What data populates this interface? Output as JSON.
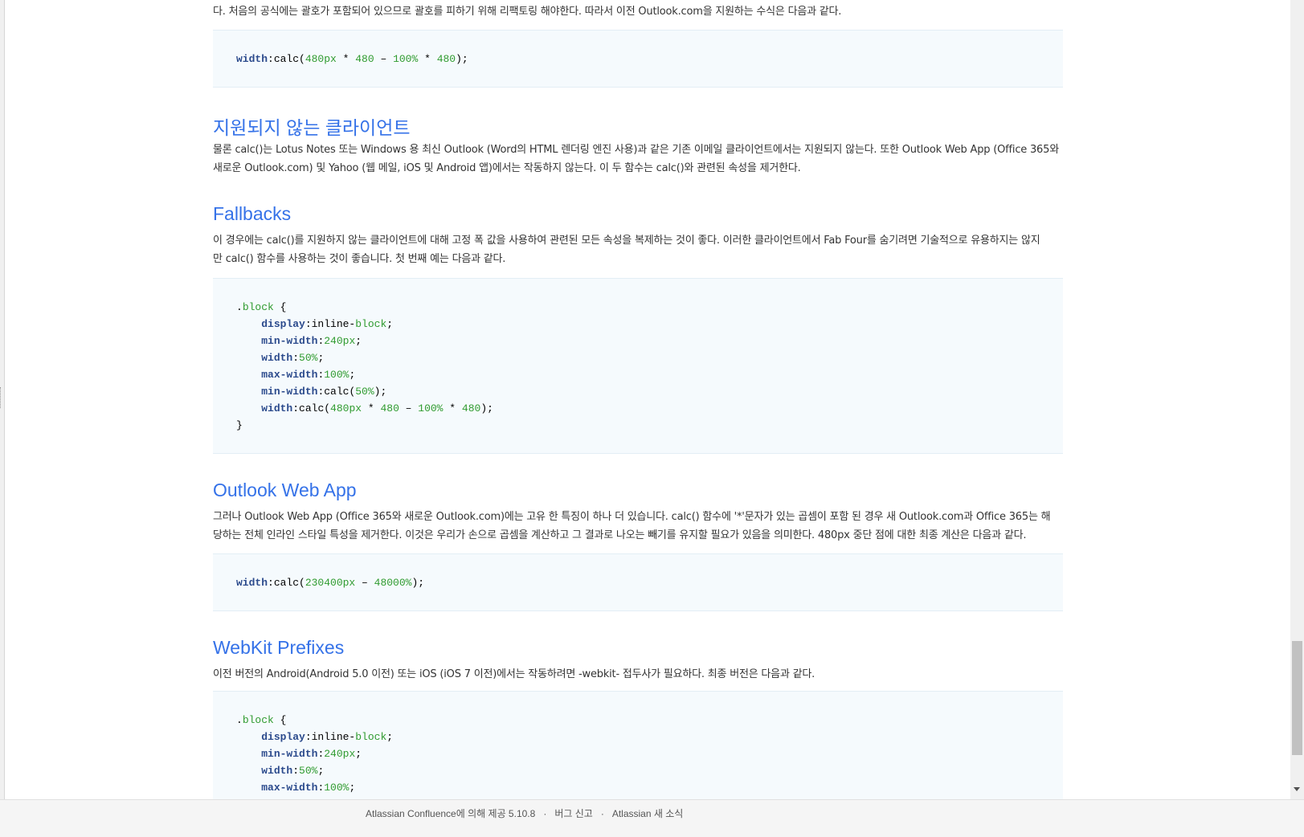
{
  "intro_paragraph": "다. 처음의 공식에는 괄호가 포함되어 있으므로 괄호를 피하기 위해 리팩토링 해야한다. 따라서 이전 Outlook.com을 지원하는 수식은 다음과 같다.",
  "code1": [
    [
      [
        "prop",
        "width"
      ],
      [
        "t",
        ":calc("
      ],
      [
        "num",
        "480px"
      ],
      [
        "t",
        " * "
      ],
      [
        "num",
        "480"
      ],
      [
        "t",
        " – "
      ],
      [
        "num",
        "100%"
      ],
      [
        "t",
        " * "
      ],
      [
        "num",
        "480"
      ],
      [
        "t",
        ");"
      ]
    ]
  ],
  "section_unsupported": {
    "title": "지원되지 않는 클라이언트",
    "line1": "물론 calc()는 Lotus Notes 또는 Windows 용 최신 Outlook (Word의 HTML 렌더링 엔진 사용)과 같은 기존 이메일 클라이언트에서는 지원되지 않는다. 또한 Outlook Web App (Office 365와",
    "line2": "새로운 Outlook.com) 및 Yahoo (웹 메일, iOS 및 Android 앱)에서는 작동하지 않는다. 이 두 함수는 calc()와 관련된 속성을 제거한다."
  },
  "section_fallbacks": {
    "title": "Fallbacks",
    "line1": "이 경우에는 calc()를 지원하지 않는 클라이언트에 대해 고정 폭 값을 사용하여 관련된 모든 속성을 복제하는 것이 좋다. 이러한 클라이언트에서 Fab Four를 숨기려면 기술적으로 유용하지는 않지",
    "line2": "만 calc() 함수를 사용하는 것이 좋습니다. 첫 번째 예는 다음과 같다."
  },
  "code2": [
    [
      [
        "t",
        "."
      ],
      [
        "cls",
        "block"
      ],
      [
        "t",
        " {"
      ]
    ],
    [
      [
        "t",
        "    "
      ],
      [
        "prop",
        "display"
      ],
      [
        "t",
        ":inline-"
      ],
      [
        "cls",
        "block"
      ],
      [
        "t",
        ";"
      ]
    ],
    [
      [
        "t",
        "    "
      ],
      [
        "prop",
        "min-width"
      ],
      [
        "t",
        ":"
      ],
      [
        "num",
        "240px"
      ],
      [
        "t",
        ";"
      ]
    ],
    [
      [
        "t",
        "    "
      ],
      [
        "prop",
        "width"
      ],
      [
        "t",
        ":"
      ],
      [
        "num",
        "50%"
      ],
      [
        "t",
        ";"
      ]
    ],
    [
      [
        "t",
        "    "
      ],
      [
        "prop",
        "max-width"
      ],
      [
        "t",
        ":"
      ],
      [
        "num",
        "100%"
      ],
      [
        "t",
        ";"
      ]
    ],
    [
      [
        "t",
        "    "
      ],
      [
        "prop",
        "min-width"
      ],
      [
        "t",
        ":calc("
      ],
      [
        "num",
        "50%"
      ],
      [
        "t",
        ");"
      ]
    ],
    [
      [
        "t",
        "    "
      ],
      [
        "prop",
        "width"
      ],
      [
        "t",
        ":calc("
      ],
      [
        "num",
        "480px"
      ],
      [
        "t",
        " * "
      ],
      [
        "num",
        "480"
      ],
      [
        "t",
        " – "
      ],
      [
        "num",
        "100%"
      ],
      [
        "t",
        " * "
      ],
      [
        "num",
        "480"
      ],
      [
        "t",
        ");"
      ]
    ],
    [
      [
        "t",
        "}"
      ]
    ]
  ],
  "section_owa": {
    "title": "Outlook Web App",
    "line1": "그러나 Outlook Web App (Office 365와 새로운 Outlook.com)에는 고유 한 특징이 하나 더 있습니다. calc() 함수에 '*'문자가 있는 곱셈이 포함 된 경우 새 Outlook.com과 Office 365는 해",
    "line2": "당하는 전체 인라인 스타일 특성을 제거한다. 이것은 우리가 손으로 곱셈을 계산하고 그 결과로 나오는 빼기를 유지할 필요가 있음을 의미한다. 480px 중단 점에 대한 최종 계산은 다음과 같다."
  },
  "code3": [
    [
      [
        "prop",
        "width"
      ],
      [
        "t",
        ":calc("
      ],
      [
        "num",
        "230400px"
      ],
      [
        "t",
        " – "
      ],
      [
        "num",
        "48000%"
      ],
      [
        "t",
        ");"
      ]
    ]
  ],
  "section_webkit": {
    "title": "WebKit Prefixes",
    "line1": "이전 버전의 Android(Android 5.0 이전) 또는 iOS (iOS 7 이전)에서는 작동하려면 -webkit- 접두사가 필요하다. 최종 버전은 다음과 같다."
  },
  "code4": [
    [
      [
        "t",
        "."
      ],
      [
        "cls",
        "block"
      ],
      [
        "t",
        " {"
      ]
    ],
    [
      [
        "t",
        "    "
      ],
      [
        "prop",
        "display"
      ],
      [
        "t",
        ":inline-"
      ],
      [
        "cls",
        "block"
      ],
      [
        "t",
        ";"
      ]
    ],
    [
      [
        "t",
        "    "
      ],
      [
        "prop",
        "min-width"
      ],
      [
        "t",
        ":"
      ],
      [
        "num",
        "240px"
      ],
      [
        "t",
        ";"
      ]
    ],
    [
      [
        "t",
        "    "
      ],
      [
        "prop",
        "width"
      ],
      [
        "t",
        ":"
      ],
      [
        "num",
        "50%"
      ],
      [
        "t",
        ";"
      ]
    ],
    [
      [
        "t",
        "    "
      ],
      [
        "prop",
        "max-width"
      ],
      [
        "t",
        ":"
      ],
      [
        "num",
        "100%"
      ],
      [
        "t",
        ";"
      ]
    ]
  ],
  "footer": {
    "powered_by": "Atlassian Confluence에 의해 제공 5.10.8",
    "separator": "·",
    "bug_report": "버그 신고",
    "news": "Atlassian 새 소식"
  }
}
